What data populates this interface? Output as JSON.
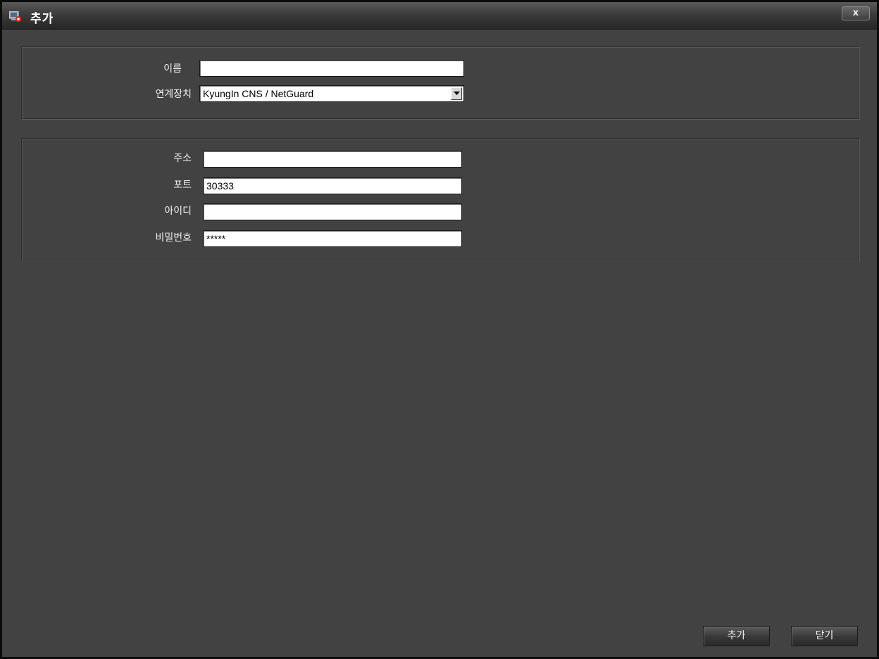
{
  "window": {
    "title": "추가",
    "close_label": "x"
  },
  "general": {
    "name_label": "이름",
    "name_value": "",
    "device_label": "연계장치",
    "device_value": "KyungIn CNS / NetGuard"
  },
  "connection": {
    "address_label": "주소",
    "address_value": "",
    "port_label": "포트",
    "port_value": "30333",
    "id_label": "아이디",
    "id_value": "",
    "password_label": "비밀번호",
    "password_value": "*****"
  },
  "footer": {
    "add_label": "추가",
    "close_label": "닫기"
  },
  "icons": {
    "title_icon": "add-device-icon",
    "dropdown_icon": "chevron-down-icon"
  },
  "colors": {
    "background": "#424242",
    "titlebar": "#2a2a2a",
    "text": "#f2f2f2"
  }
}
